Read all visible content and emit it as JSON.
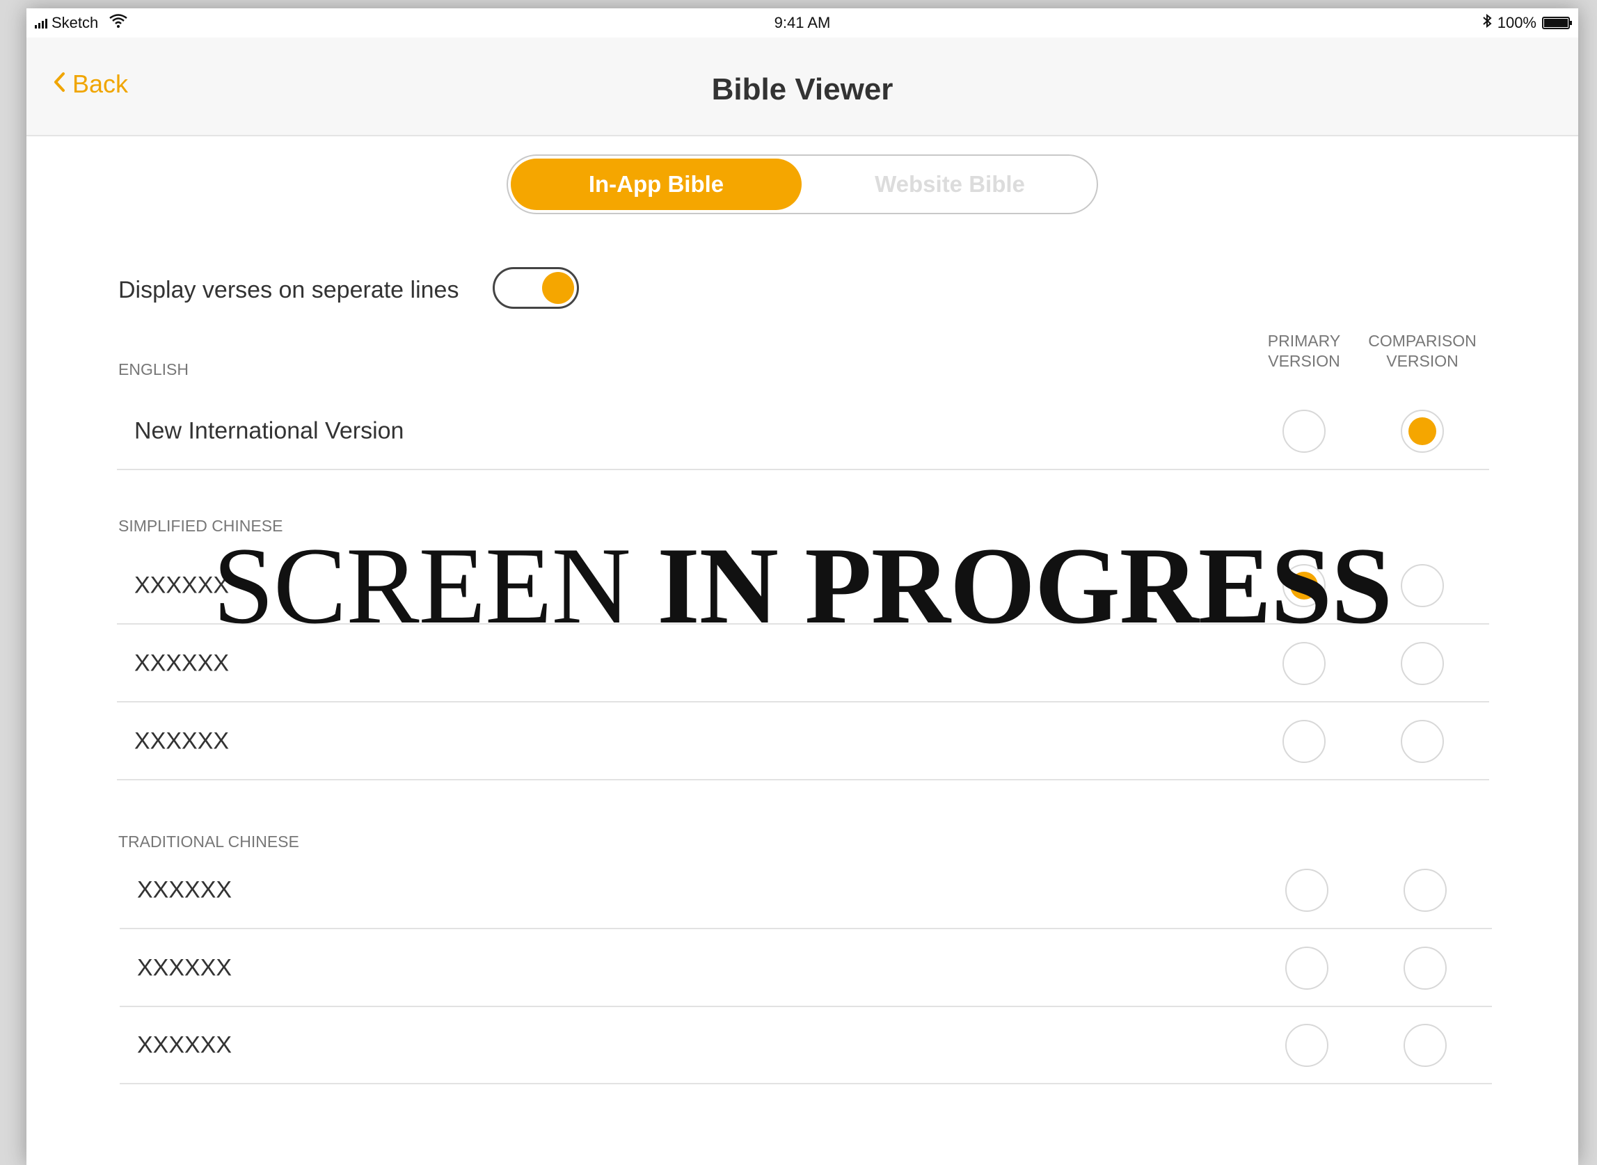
{
  "status_bar": {
    "carrier": "Sketch",
    "time": "9:41 AM",
    "battery_percent": "100%",
    "battery_level": 1.0,
    "icons": [
      "signal-bars-icon",
      "wifi-icon",
      "bluetooth-icon",
      "battery-icon"
    ]
  },
  "nav": {
    "back_label": "Back",
    "title": "Bible Viewer"
  },
  "segments": {
    "active": "In-App Bible",
    "inactive": "Website Bible",
    "selected_index": 0
  },
  "settings": {
    "separate_lines_label": "Display verses on seperate lines",
    "separate_lines_on": true
  },
  "columns": {
    "primary": [
      "PRIMARY",
      "VERSION"
    ],
    "comparison": [
      "COMPARISON",
      "VERSION"
    ]
  },
  "sections": {
    "english": {
      "title": "ENGLISH",
      "rows": [
        {
          "label": "New International Version",
          "primary": false,
          "comparison": true
        }
      ]
    },
    "simplified": {
      "title": "SIMPLIFIED CHINESE",
      "rows": [
        {
          "label": "XXXXXX",
          "primary": true,
          "comparison": false
        },
        {
          "label": "XXXXXX",
          "primary": false,
          "comparison": false
        },
        {
          "label": "XXXXXX",
          "primary": false,
          "comparison": false
        }
      ]
    },
    "traditional": {
      "title": "TRADITIONAL CHINESE",
      "rows": [
        {
          "label": "XXXXXX",
          "primary": false,
          "comparison": false
        },
        {
          "label": "XXXXXX",
          "primary": false,
          "comparison": false
        },
        {
          "label": "XXXXXX",
          "primary": false,
          "comparison": false
        }
      ]
    }
  },
  "watermark": {
    "word1": "SCREEN",
    "word2": "IN PROGRESS"
  },
  "colors": {
    "accent": "#f5a600",
    "title_text": "#333333",
    "muted_text": "#777777"
  }
}
